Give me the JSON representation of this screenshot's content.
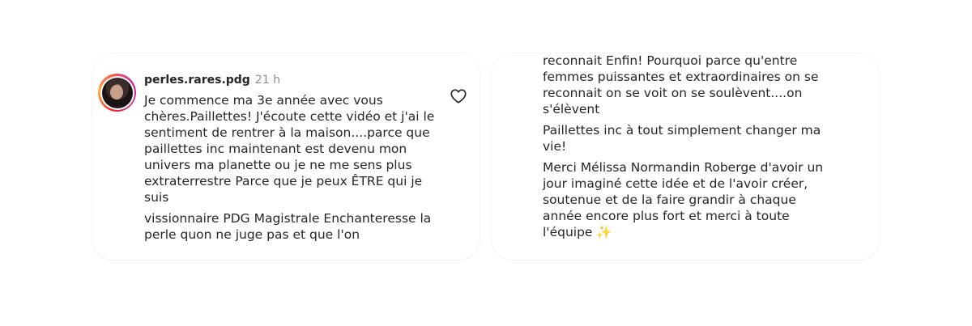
{
  "comment": {
    "username": "perles.rares.pdg",
    "timestamp": "21 h",
    "paragraphs_left": [
      "Je commence ma 3e année avec vous chères.Paillettes! J'écoute cette vidéo et j'ai le sentiment de rentrer à la maison....parce que paillettes inc maintenant est devenu mon univers ma planette ou je ne me sens plus extraterrestre Parce que je peux ÊTRE qui je suis",
      "vissionnaire PDG Magistrale Enchanteresse la perle quon ne juge pas et que l'on"
    ],
    "paragraphs_right": [
      "reconnait Enfin! Pourquoi parce qu'entre femmes puissantes et extraordinaires on se reconnait on se voit on se soulèvent....on s'élèvent",
      "Paillettes inc à tout simplement changer ma vie!",
      "Merci Mélissa Normandin Roberge d'avoir un jour imaginé cette idée et de l'avoir créer, soutenue et de la faire grandir à chaque année encore plus fort et merci à toute l'équipe ✨"
    ],
    "like_icon": "heart-outline-icon",
    "avatar_ring_colors": [
      "#fd1d1d",
      "#fcaf45",
      "#d6249f",
      "#c13584"
    ]
  }
}
